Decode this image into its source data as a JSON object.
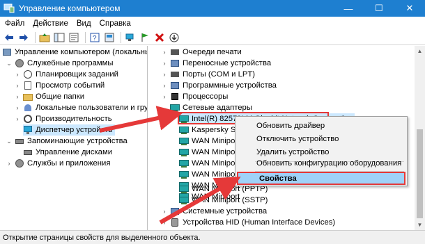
{
  "window": {
    "title": "Управление компьютером",
    "controls": {
      "minimize": "—",
      "maximize": "☐",
      "close": "✕"
    }
  },
  "menu": [
    "Файл",
    "Действие",
    "Вид",
    "Справка"
  ],
  "toolbar": {
    "icons": [
      "back-arrow-icon",
      "forward-arrow-icon",
      "up-folder-icon",
      "show-tree-icon",
      "properties-icon",
      "help-icon",
      "console-icon",
      "scan-hardware-icon",
      "uninstall-icon",
      "update-driver-icon"
    ]
  },
  "left_tree": [
    {
      "label": "Управление компьютером (локальным)",
      "icon": "computer-mgmt-icon",
      "expander": ""
    },
    {
      "label": "Служебные программы",
      "icon": "tools-icon",
      "expander": "⌄"
    },
    {
      "label": "Планировщик заданий",
      "icon": "clock-icon",
      "expander": "›"
    },
    {
      "label": "Просмотр событий",
      "icon": "event-log-icon",
      "expander": "›"
    },
    {
      "label": "Общие папки",
      "icon": "shared-folder-icon",
      "expander": "›"
    },
    {
      "label": "Локальные пользователи и группы",
      "icon": "users-icon",
      "expander": "›"
    },
    {
      "label": "Производительность",
      "icon": "performance-icon",
      "expander": "›"
    },
    {
      "label": "Диспетчер устройств",
      "icon": "device-manager-icon",
      "expander": ""
    },
    {
      "label": "Запоминающие устройства",
      "icon": "storage-icon",
      "expander": "⌄"
    },
    {
      "label": "Управление дисками",
      "icon": "disk-icon",
      "expander": ""
    },
    {
      "label": "Службы и приложения",
      "icon": "services-icon",
      "expander": "›"
    }
  ],
  "right_tree": [
    {
      "label": "Очереди печати",
      "icon": "printer-icon",
      "expander": "›"
    },
    {
      "label": "Переносные устройства",
      "icon": "portable-device-icon",
      "expander": "›"
    },
    {
      "label": "Порты (COM и LPT)",
      "icon": "port-icon",
      "expander": "›"
    },
    {
      "label": "Программные устройства",
      "icon": "software-device-icon",
      "expander": "›"
    },
    {
      "label": "Процессоры",
      "icon": "cpu-icon",
      "expander": "›"
    },
    {
      "label": "Сетевые адаптеры",
      "icon": "network-adapter-icon",
      "expander": "⌄"
    },
    {
      "label": "Intel(R) 82579LM Gigabit Network Connection",
      "icon": "network-card-icon",
      "expander": ""
    },
    {
      "label": "Kaspersky Secu",
      "icon": "network-card-icon",
      "expander": ""
    },
    {
      "label": "WAN Miniport",
      "icon": "network-card-icon",
      "expander": ""
    },
    {
      "label": "WAN Miniport",
      "icon": "network-card-icon",
      "expander": ""
    },
    {
      "label": "WAN Miniport",
      "icon": "network-card-icon",
      "expander": ""
    },
    {
      "label": "WAN Miniport",
      "icon": "network-card-icon",
      "expander": ""
    },
    {
      "label": "WAN Miniport",
      "icon": "network-card-icon",
      "expander": ""
    },
    {
      "label": "WAN Miniport",
      "icon": "network-card-icon",
      "expander": ""
    },
    {
      "label": "WAN Miniport (PPTP)",
      "icon": "network-card-icon",
      "expander": ""
    },
    {
      "label": "WAN Miniport (SSTP)",
      "icon": "network-card-icon",
      "expander": ""
    },
    {
      "label": "Системные устройства",
      "icon": "system-device-icon",
      "expander": "›"
    },
    {
      "label": "Устройства HID (Human Interface Devices)",
      "icon": "hid-icon",
      "expander": "›"
    }
  ],
  "context_menu": {
    "items": [
      "Обновить драйвер",
      "Отключить устройство",
      "Удалить устройство",
      "Обновить конфигурацию оборудования",
      "Свойства"
    ]
  },
  "status": {
    "text": "Открытие страницы свойств для выделенного объекта."
  },
  "colors": {
    "titlebar": "#1e7fd0",
    "selection": "#cce8ff",
    "annotation": "#e53939",
    "menu_highlight": "#9fd2f8"
  }
}
